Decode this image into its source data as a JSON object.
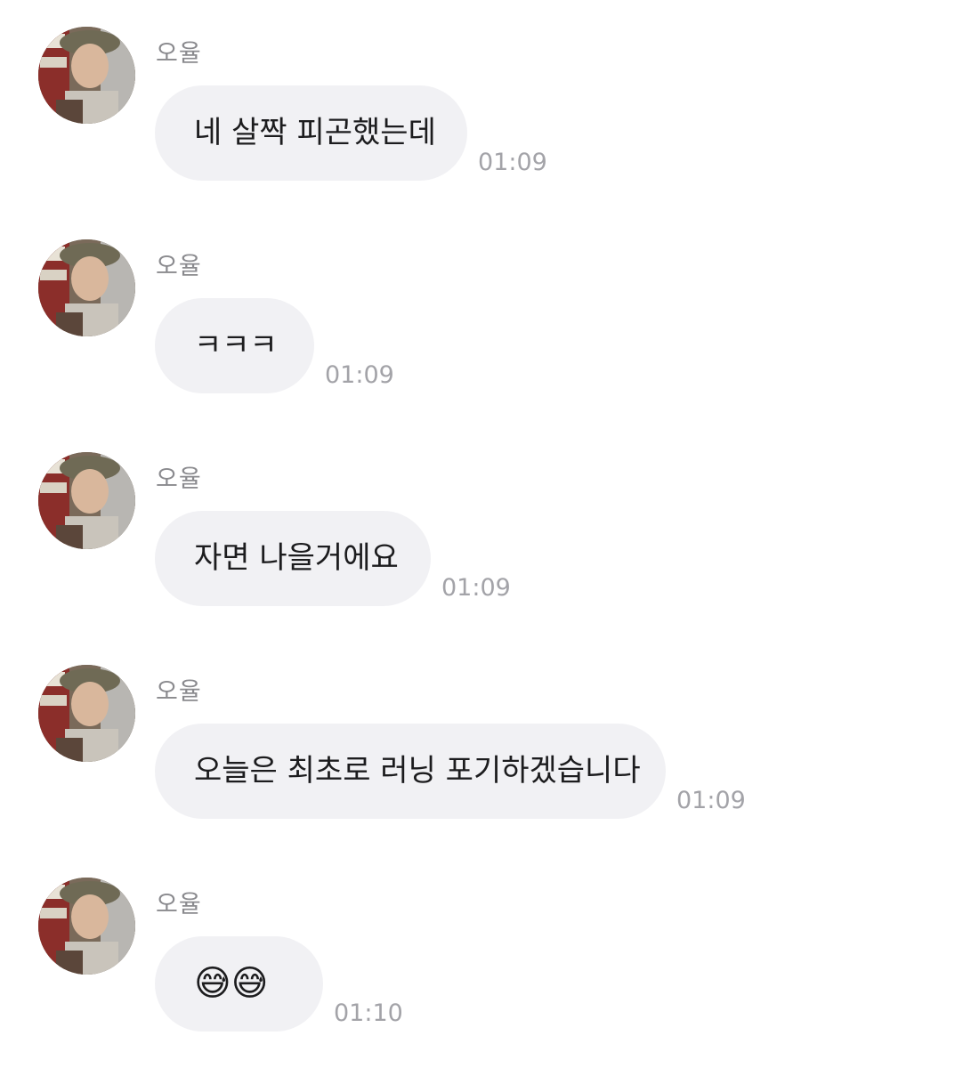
{
  "chat": {
    "messages": [
      {
        "sender": "오율",
        "text": "네 살짝 피곤했는데",
        "time": "01:09"
      },
      {
        "sender": "오율",
        "text": "ㅋㅋㅋ",
        "time": "01:09"
      },
      {
        "sender": "오율",
        "text": "자면 나을거에요",
        "time": "01:09"
      },
      {
        "sender": "오율",
        "text": "오늘은 최초로 러닝 포기하겠습니다",
        "time": "01:09"
      },
      {
        "sender": "오율",
        "text": "😅😅",
        "time": "01:10"
      }
    ]
  },
  "colors": {
    "bubble_bg": "#f1f1f4",
    "sender_text": "#8a8a8e",
    "timestamp_text": "#a3a3a8",
    "message_text": "#1c1c1e"
  }
}
